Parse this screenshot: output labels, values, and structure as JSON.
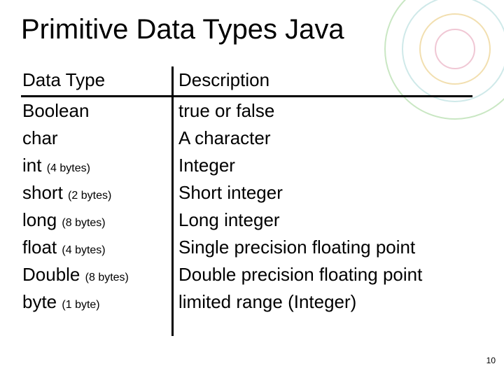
{
  "title": "Primitive Data Types Java",
  "table": {
    "header": {
      "type": "Data Type",
      "desc": "Description"
    },
    "rows": [
      {
        "type": "Boolean",
        "size": "",
        "desc": "true or false"
      },
      {
        "type": "char",
        "size": "",
        "desc": "A character"
      },
      {
        "type": "int",
        "size": "(4 bytes)",
        "desc": "Integer"
      },
      {
        "type": "short",
        "size": "(2 bytes)",
        "desc": "Short integer"
      },
      {
        "type": "long",
        "size": "(8 bytes)",
        "desc": "Long integer"
      },
      {
        "type": "float",
        "size": "(4 bytes)",
        "desc": "Single precision floating point"
      },
      {
        "type": "Double",
        "size": "(8 bytes)",
        "desc": "Double precision floating point"
      },
      {
        "type": "byte",
        "size": "(1 byte)",
        "desc": "limited range (Integer)"
      }
    ]
  },
  "page_number": "10"
}
